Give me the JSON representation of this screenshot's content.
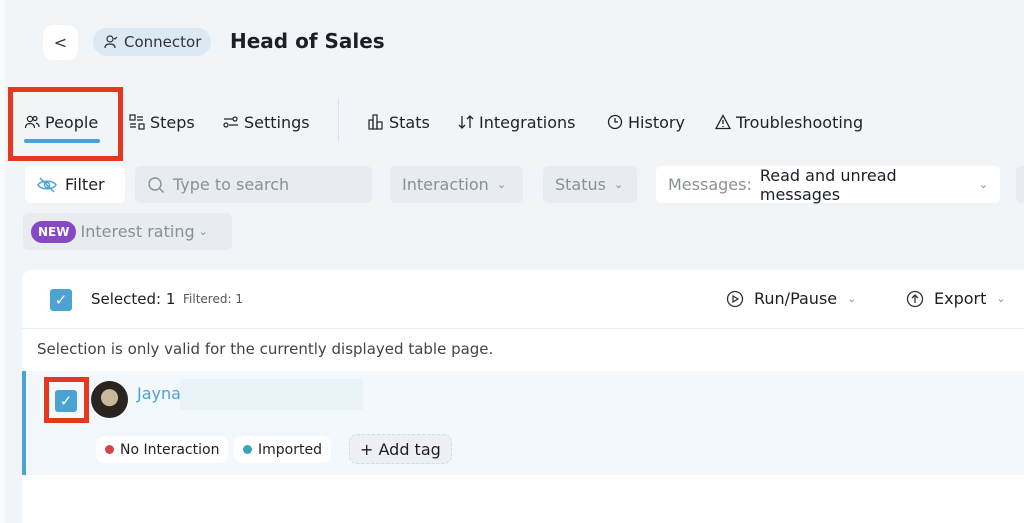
{
  "header": {
    "back_label": "<",
    "badge": "Connector",
    "title": "Head of Sales"
  },
  "tabs": [
    {
      "label": "People",
      "icon": "people-icon",
      "active": true
    },
    {
      "label": "Steps",
      "icon": "steps-icon"
    },
    {
      "label": "Settings",
      "icon": "settings-icon"
    },
    {
      "label": "Stats",
      "icon": "stats-icon"
    },
    {
      "label": "Integrations",
      "icon": "integrations-icon"
    },
    {
      "label": "History",
      "icon": "history-icon"
    },
    {
      "label": "Troubleshooting",
      "icon": "warning-icon"
    }
  ],
  "filters": {
    "filter_label": "Filter",
    "search_placeholder": "Type to search",
    "interaction": "Interaction",
    "status": "Status",
    "messages_label": "Messages:",
    "messages_value": "Read and unread messages",
    "new_badge": "NEW",
    "interest": "Interest rating"
  },
  "table": {
    "selected": "Selected: 1",
    "filtered": "Filtered: 1",
    "run_pause": "Run/Pause",
    "export": "Export",
    "notice": "Selection is only valid for the currently displayed table page."
  },
  "rows": [
    {
      "name": "Jayna",
      "tags": [
        {
          "label": "No Interaction",
          "color": "#d8404a"
        },
        {
          "label": "Imported",
          "color": "#3fa3b8"
        }
      ],
      "add_tag": "+ Add tag",
      "selected": true
    }
  ]
}
